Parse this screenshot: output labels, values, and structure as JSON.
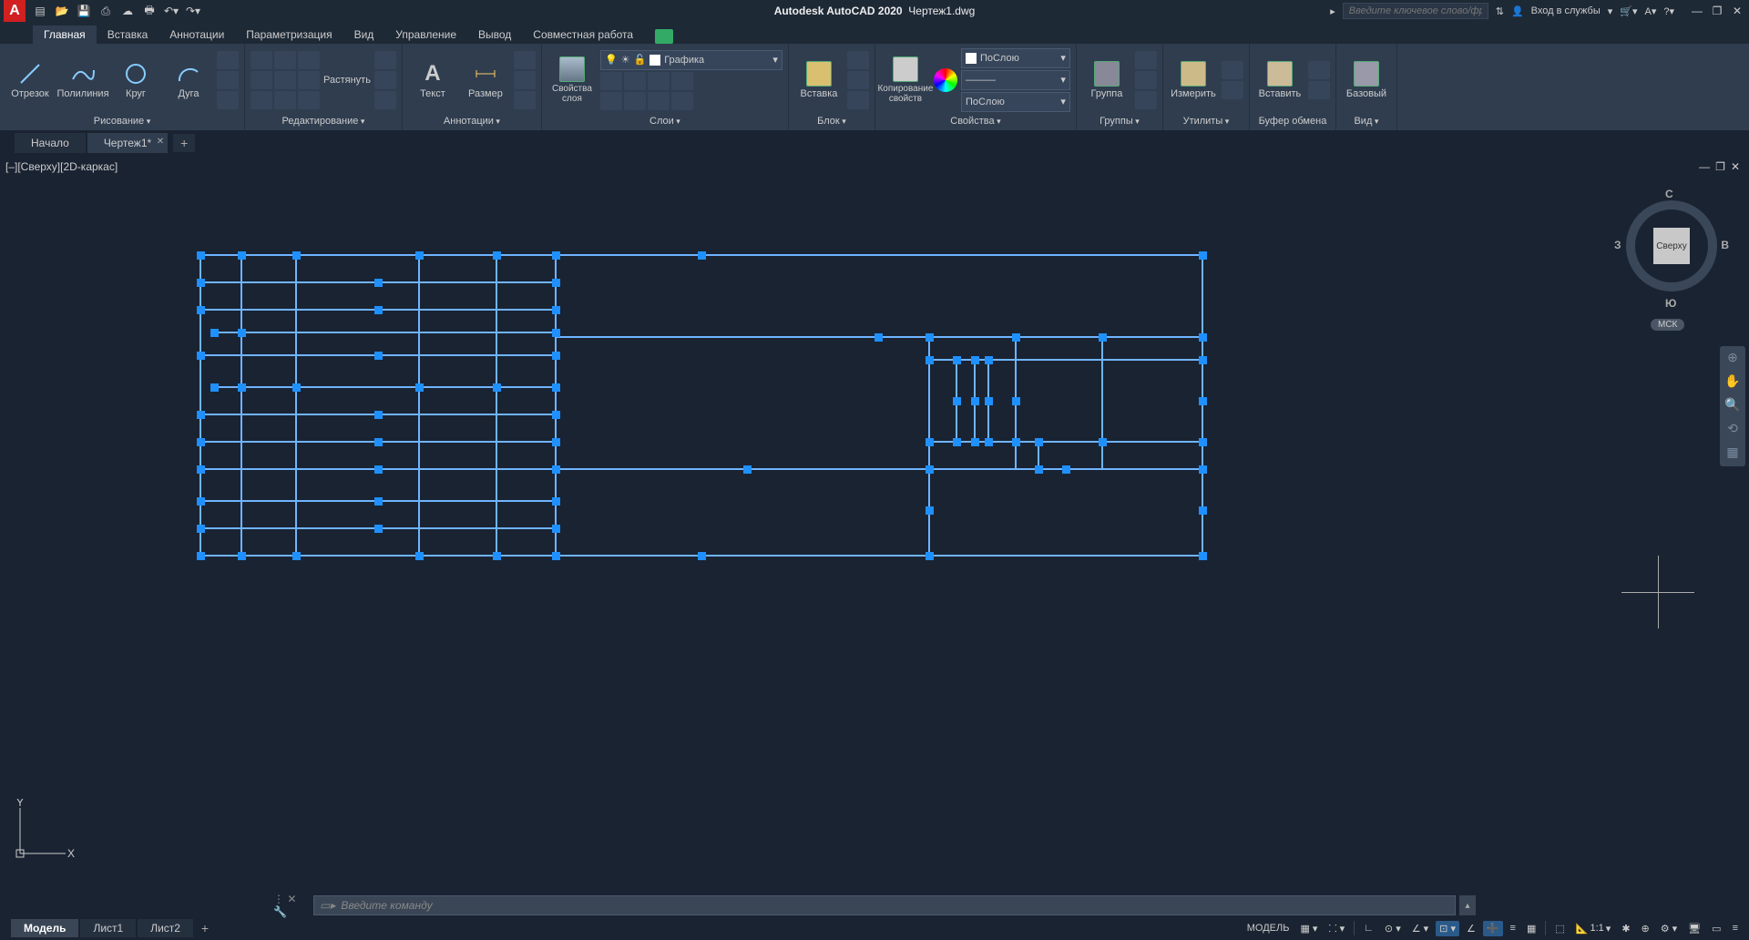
{
  "app": {
    "name": "Autodesk AutoCAD 2020",
    "file": "Чертеж1.dwg",
    "logo": "A"
  },
  "search": {
    "placeholder": "Введите ключевое слово/фразу"
  },
  "account": {
    "signin": "Вход в службы",
    "help": "?"
  },
  "menu": {
    "tabs": [
      "Главная",
      "Вставка",
      "Аннотации",
      "Параметризация",
      "Вид",
      "Управление",
      "Вывод",
      "Совместная работа"
    ],
    "active": 0
  },
  "ribbon": {
    "panels": {
      "draw": {
        "title": "Рисование",
        "btns": [
          "Отрезок",
          "Полилиния",
          "Круг",
          "Дуга"
        ]
      },
      "modify": {
        "title": "Редактирование",
        "stretch": "Растянуть"
      },
      "annot": {
        "title": "Аннотации",
        "text": "Текст",
        "dim": "Размер"
      },
      "layers": {
        "title": "Слои",
        "props": "Свойства слоя",
        "current": "Графика"
      },
      "block": {
        "title": "Блок",
        "insert": "Вставка"
      },
      "props": {
        "title": "Свойства",
        "match": "Копирование свойств",
        "bylayer": "ПоСлою"
      },
      "groups": {
        "title": "Группы",
        "group": "Группа"
      },
      "utils": {
        "title": "Утилиты",
        "measure": "Измерить"
      },
      "clip": {
        "title": "Буфер обмена",
        "paste": "Вставить"
      },
      "view": {
        "title": "Вид",
        "base": "Базовый"
      }
    }
  },
  "filetabs": {
    "start": "Начало",
    "items": [
      "Чертеж1*"
    ],
    "active": 0
  },
  "viewport": {
    "label": "[–][Сверху][2D-каркас]"
  },
  "viewcube": {
    "face": "Сверху",
    "n": "С",
    "s": "Ю",
    "e": "В",
    "w": "З",
    "wcs": "МСК"
  },
  "ucs": {
    "x": "X",
    "y": "Y"
  },
  "cmd": {
    "placeholder": "Введите команду"
  },
  "layouts": {
    "items": [
      "Модель",
      "Лист1",
      "Лист2"
    ],
    "active": 0
  },
  "status": {
    "model": "МОДЕЛЬ",
    "scale": "1:1"
  }
}
